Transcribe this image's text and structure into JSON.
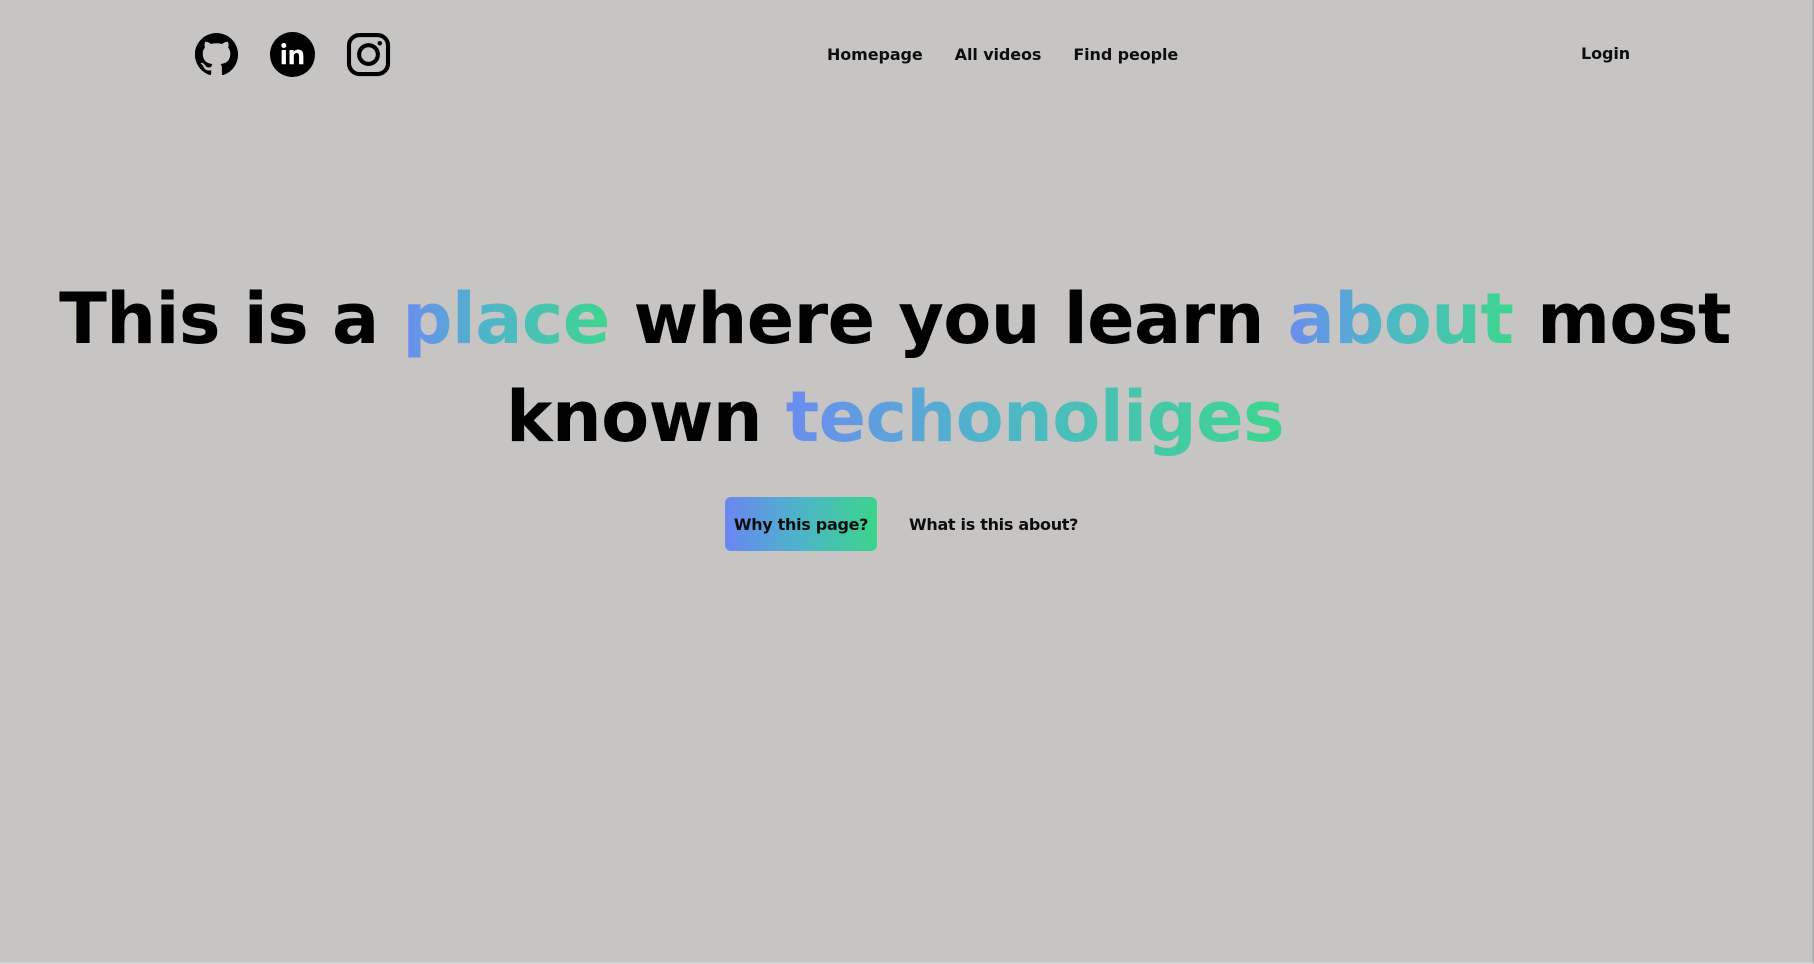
{
  "header": {
    "social": [
      {
        "icon": "github-icon"
      },
      {
        "icon": "linkedin-icon"
      },
      {
        "icon": "instagram-icon"
      }
    ],
    "nav": [
      "Homepage",
      "All videos",
      "Find people"
    ],
    "login_label": "Login"
  },
  "hero": {
    "headline": {
      "part1": "This is a ",
      "highlight1": "place",
      "part2": " where you learn ",
      "highlight2": "about",
      "part3": " most known ",
      "highlight3": "techonoliges"
    },
    "primary_cta": "Why this page?",
    "secondary_cta": "What is this about?"
  },
  "colors": {
    "background": "#c6c5c3",
    "gradient_start": "#6b8cf0",
    "gradient_end": "#3dd68e",
    "text": "#000000"
  }
}
